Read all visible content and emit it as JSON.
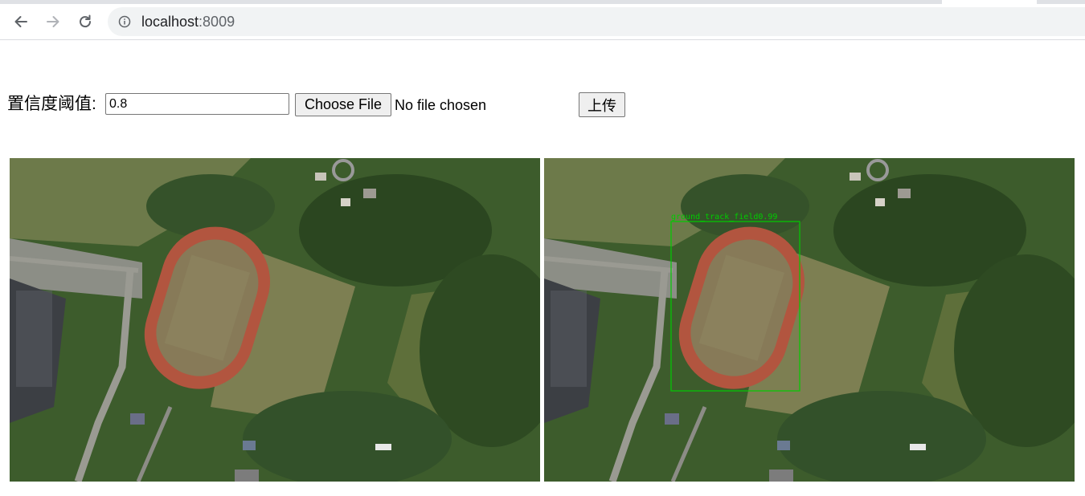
{
  "browser": {
    "url_host": "localhost",
    "url_port": ":8009",
    "icons": [
      "back-arrow-icon",
      "forward-arrow-icon",
      "reload-icon",
      "info-icon"
    ]
  },
  "form": {
    "threshold_label": "置信度阈值:",
    "threshold_value": "0.8",
    "choose_file_label": "Choose File",
    "file_status": "No file chosen",
    "upload_label": "上传"
  },
  "images": {
    "original": {
      "name": "original-aerial-image"
    },
    "result": {
      "name": "detection-result-image",
      "detections": [
        {
          "label": "ground_track_field",
          "score": "0.99",
          "box_color": "#00cc00"
        }
      ]
    }
  }
}
